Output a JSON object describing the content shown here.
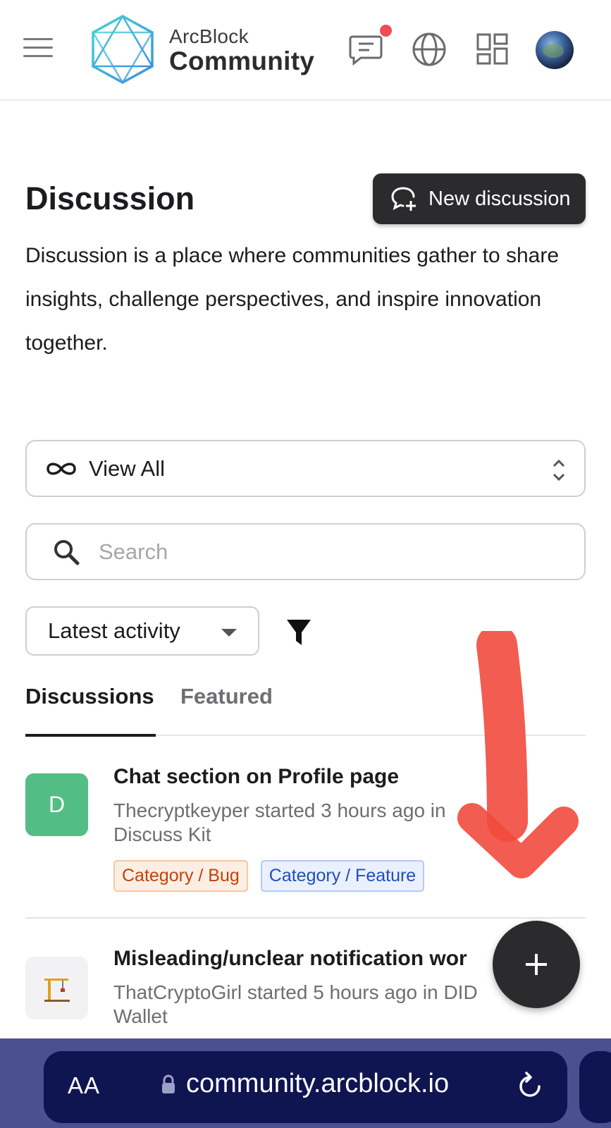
{
  "header": {
    "brand_top": "ArcBlock",
    "brand_main": "Community",
    "notification_color": "#ef4c57"
  },
  "intro": {
    "title": "Discussion",
    "new_button_label": "New discussion",
    "description": "Discussion is a place where communities gather to share insights, challenge perspectives, and inspire innovation together."
  },
  "controls": {
    "view_select_value": "View All",
    "search_placeholder": "Search",
    "sort_value": "Latest activity"
  },
  "tabs": [
    {
      "label": "Discussions",
      "active": true
    },
    {
      "label": "Featured",
      "active": false
    }
  ],
  "discussions": [
    {
      "avatar_letter": "D",
      "title": "Chat section on Profile page",
      "meta": "Thecryptkeyper started 3 hours ago in Discuss Kit",
      "tags": [
        "Category / Bug",
        "Category / Feature"
      ]
    },
    {
      "avatar_icon": "crane-icon",
      "title": "Misleading/unclear notification wor",
      "meta": "ThatCryptoGirl started 5 hours ago in DID Wallet"
    }
  ],
  "browser": {
    "text_size_label": "AA",
    "url": "community.arcblock.io"
  }
}
